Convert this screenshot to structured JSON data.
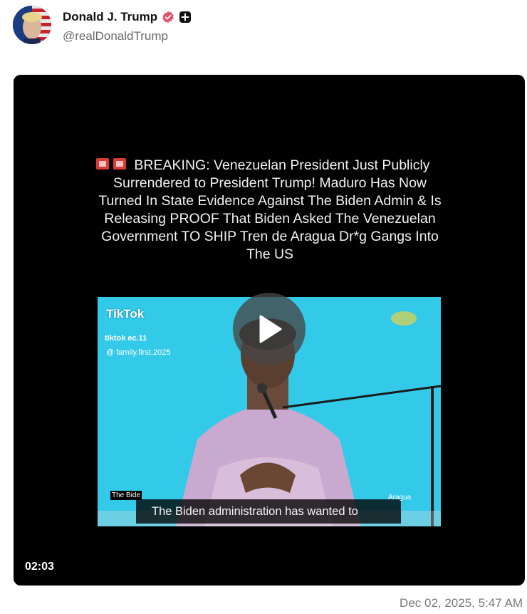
{
  "post": {
    "author": {
      "display_name": "Donald J. Trump",
      "handle": "@realDonaldTrump",
      "verified_color": "#e0556b"
    },
    "media": {
      "caption": "BREAKING: Venezuelan President Just Publicly Surrendered to President Trump! Maduro Has Now Turned In State Evidence Against The Biden Admin & Is Releasing PROOF That Biden Asked The Venezuelan Government TO SHIP Tren de Aragua Dr*g Gangs Into The US",
      "watermark": {
        "logo_text": "TikTok",
        "handle_1": "tiktok ec.11",
        "handle_2": "@ family.first.2025"
      },
      "subtitle_left": "The Bide",
      "subtitle": "The Biden administration has wanted to",
      "subtitle_right": "Aragua",
      "duration": "02:03"
    },
    "timestamp": "Dec 02, 2025, 5:47 AM"
  }
}
